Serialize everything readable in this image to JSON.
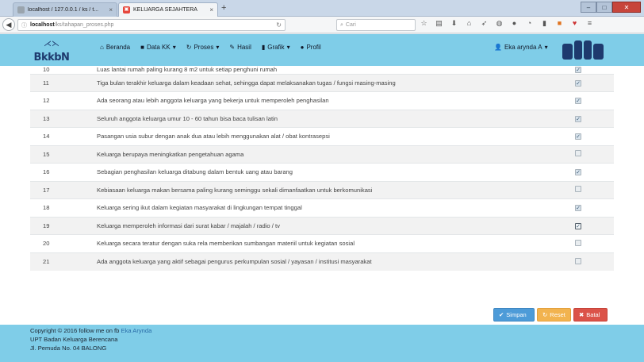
{
  "browser": {
    "tabs": [
      {
        "label": "localhost / 127.0.0.1 / ks / t...",
        "active": false
      },
      {
        "label": "KELUARGA SEJAHTERA",
        "active": true
      }
    ],
    "new_tab": "+",
    "url_host": "localhost",
    "url_path": "/ks/tahapan_proses.php",
    "search_placeholder": "Cari"
  },
  "app": {
    "logo_text": "BkkbN",
    "menu": [
      {
        "label": "Beranda",
        "icon": "home-icon"
      },
      {
        "label": "Data KK",
        "icon": "folder-icon",
        "caret": "▾"
      },
      {
        "label": "Proses",
        "icon": "refresh-icon",
        "caret": "▾"
      },
      {
        "label": "Hasil",
        "icon": "edit-icon"
      },
      {
        "label": "Grafik",
        "icon": "bar-chart-icon",
        "caret": "▾"
      },
      {
        "label": "Profil",
        "icon": "info-icon"
      }
    ],
    "user": "Eka arynda A",
    "user_caret": "▾"
  },
  "table": {
    "rows": [
      {
        "no": "10",
        "text": "Luas lantai rumah paling kurang 8 m2 untuk setiap penghuni rumah",
        "checked": true
      },
      {
        "no": "11",
        "text": "Tiga bulan terakhir keluarga dalam keadaan sehat, sehingga dapat melaksanakan tugas / fungsi masing-masing",
        "checked": true
      },
      {
        "no": "12",
        "text": "Ada seorang atau lebih anggota keluarga yang bekerja untuk memperoleh penghasilan",
        "checked": true
      },
      {
        "no": "13",
        "text": "Seluruh anggota keluarga umur 10 - 60 tahun bisa baca tulisan latin",
        "checked": true
      },
      {
        "no": "14",
        "text": "Pasangan usia subur dengan anak dua atau lebih menggunakan alat / obat kontrasepsi",
        "checked": true
      },
      {
        "no": "15",
        "text": "Keluarga berupaya meningkatkan pengetahuan agama",
        "checked": false
      },
      {
        "no": "16",
        "text": "Sebagian penghasilan keluarga ditabung dalam bentuk uang atau barang",
        "checked": true
      },
      {
        "no": "17",
        "text": "Kebiasaan keluarga makan bersama paling kurang seminggu sekali dimanfaatkan untuk berkomunikasi",
        "checked": false
      },
      {
        "no": "18",
        "text": "Keluarga sering ikut dalam kegiatan masyarakat di lingkungan tempat tinggal",
        "checked": true
      },
      {
        "no": "19",
        "text": "Keluarga memperoleh informasi dari surat kabar / majalah / radio / tv",
        "checked": true,
        "focused": true
      },
      {
        "no": "20",
        "text": "Keluarga secara teratur dengan suka rela memberikan sumbangan materiil untuk kegiatan sosial",
        "checked": false
      },
      {
        "no": "21",
        "text": "Ada anggota keluarga yang aktif sebagai pengurus perkumpulan sosial / yayasan / institusi masyarakat",
        "checked": false
      }
    ]
  },
  "buttons": {
    "save": "Simpan",
    "reset": "Reset",
    "cancel": "Batal"
  },
  "footer": {
    "line1_prefix": "Copyright © 2016 follow me on fb",
    "line1_link": "Eka Arynda",
    "line2": "UPT Badan Keluarga Berencana",
    "line3": "Jl. Pemuda No. 04 BALONG"
  }
}
